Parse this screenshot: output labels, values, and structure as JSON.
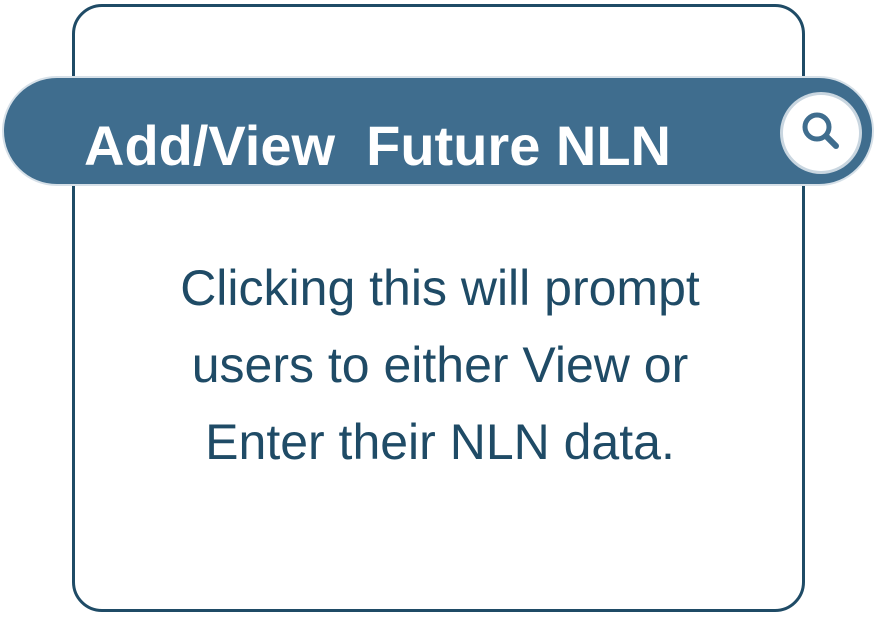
{
  "banner": {
    "title": "Add/View  Future NLN",
    "search_icon": "magnifier-icon",
    "colors": {
      "banner_fill": "#3f6d8e",
      "border": "#1f4b66",
      "text": "#1f4b66"
    }
  },
  "description": {
    "lines": [
      "Clicking this will prompt",
      "users to either View or",
      "Enter their NLN data."
    ]
  }
}
